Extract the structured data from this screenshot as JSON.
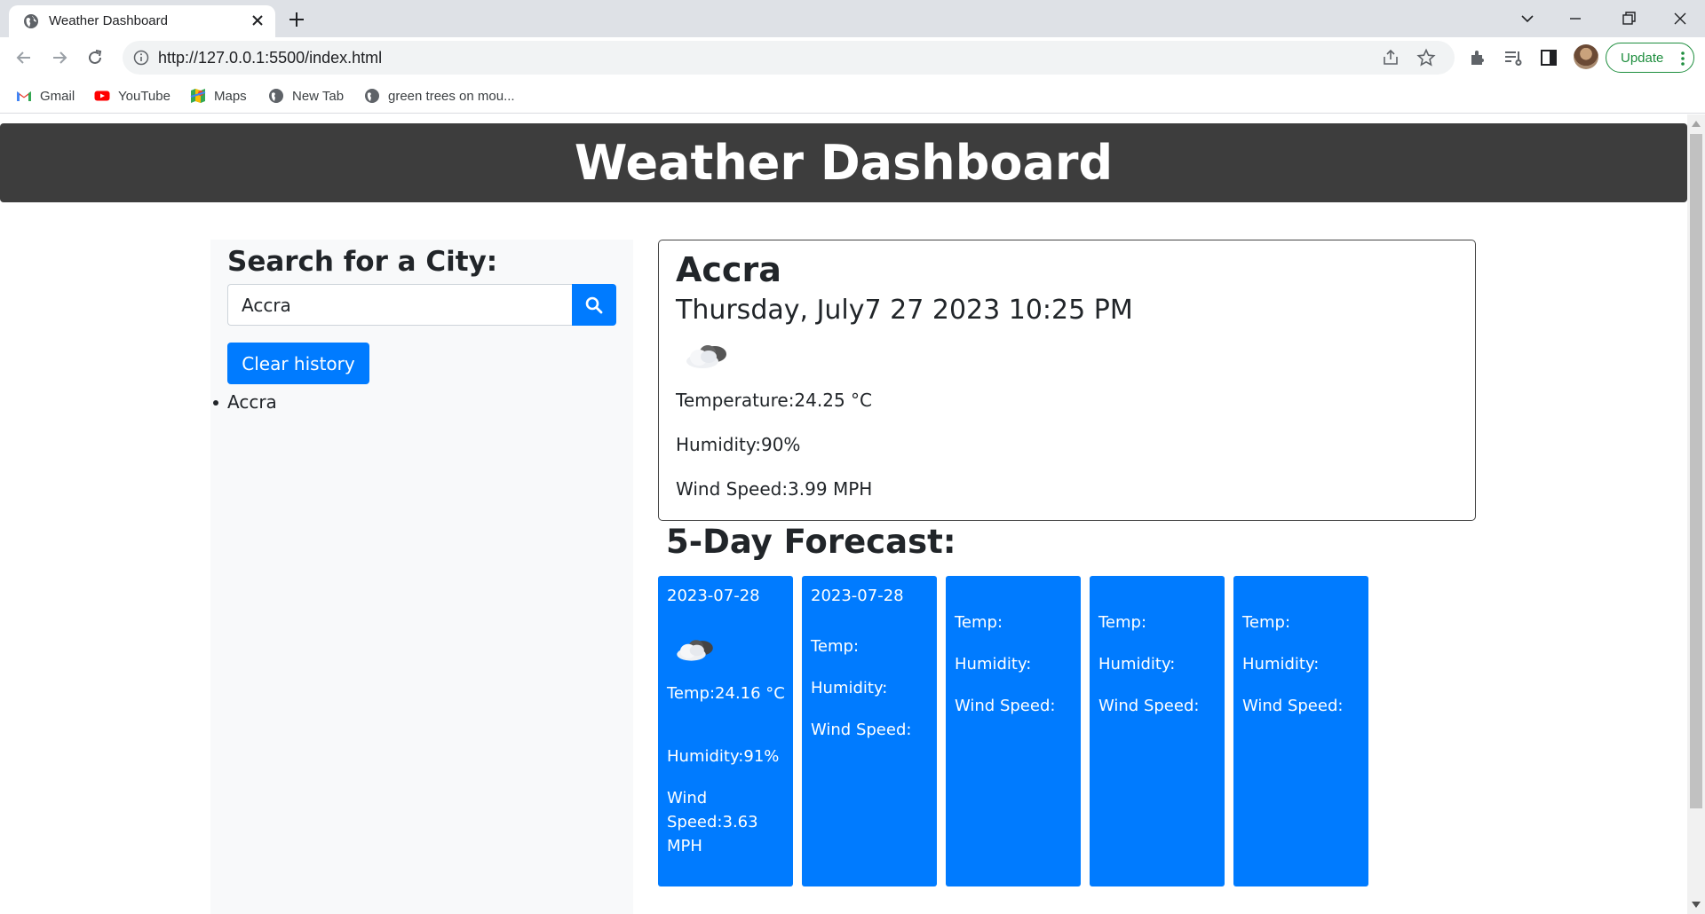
{
  "browser": {
    "tab_title": "Weather Dashboard",
    "url": "http://127.0.0.1:5500/index.html",
    "update_label": "Update",
    "bookmarks": [
      {
        "label": "Gmail",
        "icon": "gmail-icon"
      },
      {
        "label": "YouTube",
        "icon": "youtube-icon"
      },
      {
        "label": "Maps",
        "icon": "maps-icon"
      },
      {
        "label": "New Tab",
        "icon": "globe-icon"
      },
      {
        "label": "green trees on mou...",
        "icon": "globe-icon"
      }
    ]
  },
  "page": {
    "header_title": "Weather Dashboard",
    "search": {
      "heading": "Search for a City:",
      "value": "Accra",
      "search_icon": "search-icon",
      "clear_label": "Clear history",
      "history": [
        "Accra"
      ]
    },
    "current": {
      "city": "Accra",
      "date": "Thursday, July7 27 2023 10:25 PM",
      "icon": "night-cloud-icon",
      "temperature": "Temperature:24.25 °C",
      "humidity": "Humidity:90%",
      "wind": "Wind Speed:3.99 MPH"
    },
    "forecast_title": "5-Day Forecast:",
    "forecast": [
      {
        "date": "2023-07-28",
        "icon": "night-cloud-icon",
        "temp": "Temp:24.16 °C",
        "humidity": "Humidity:91%",
        "wind": "Wind Speed:3.63 MPH"
      },
      {
        "date": "2023-07-28",
        "icon": "",
        "temp": "Temp:",
        "humidity": "Humidity:",
        "wind": "Wind Speed:"
      },
      {
        "date": "",
        "icon": "",
        "temp": "Temp:",
        "humidity": "Humidity:",
        "wind": "Wind Speed:"
      },
      {
        "date": "",
        "icon": "",
        "temp": "Temp:",
        "humidity": "Humidity:",
        "wind": "Wind Speed:"
      },
      {
        "date": "",
        "icon": "",
        "temp": "Temp:",
        "humidity": "Humidity:",
        "wind": "Wind Speed:"
      }
    ]
  },
  "colors": {
    "header_bg": "#3d3d3d",
    "accent": "#007bff",
    "sidebar_bg": "#f8f9fa"
  }
}
